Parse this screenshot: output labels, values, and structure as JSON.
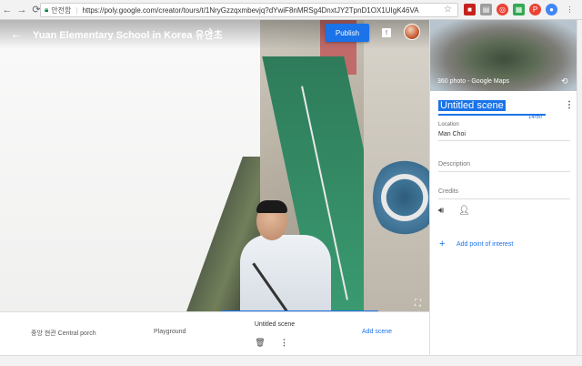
{
  "browser": {
    "secure_label": "안전함",
    "url": "https://poly.google.com/creator/tours/t/1NryGzzqxmbevjq?dYwiF8nMRSg4DnxtJY2TpnD1OX1UIgK46VA"
  },
  "header": {
    "tour_title": "Yuan Elementary School in Korea 유안초",
    "publish_label": "Publish"
  },
  "scenes": {
    "items": [
      "중앙 현관 Central porch",
      "Playground"
    ],
    "current": "Untitled scene",
    "add_label": "Add scene"
  },
  "panel": {
    "thumb_caption": "360 photo - Google Maps",
    "scene_name": "Untitled scene",
    "char_count": "14/50",
    "location_label": "Location",
    "location_value": "Man Choi",
    "description_label": "Description",
    "credits_label": "Credits",
    "add_poi_label": "Add point of interest"
  },
  "colors": {
    "accent": "#1a73e8"
  }
}
